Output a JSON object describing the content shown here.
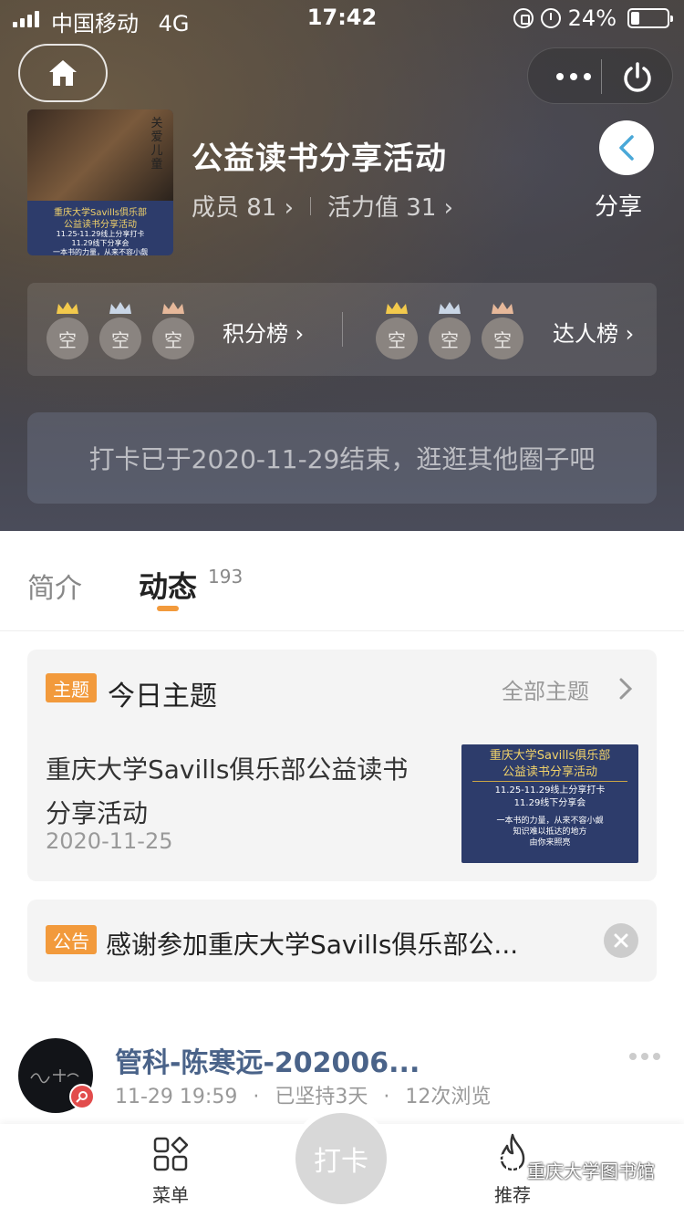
{
  "status": {
    "carrier": "中国移动",
    "network": "4G",
    "time": "17:42",
    "battery": "24%",
    "battery_level": 0.24
  },
  "circle": {
    "title": "公益读书分享活动",
    "members_label": "成员 81",
    "vitality_label": "活力值 31",
    "share_label": "分享",
    "cover": {
      "tag": "关爱儿童",
      "line1": "重庆大学Savills俱乐部",
      "line2": "公益读书分享活动",
      "line3": "11.25-11.29线上分享打卡",
      "line4": "11.29线下分享会",
      "line5": "一本书的力量，从来不容小觑"
    }
  },
  "ranks": {
    "points": {
      "label": "积分榜",
      "slots": [
        "空",
        "空",
        "空"
      ]
    },
    "experts": {
      "label": "达人榜",
      "slots": [
        "空",
        "空",
        "空"
      ]
    }
  },
  "notice": "打卡已于2020-11-29结束，逛逛其他圈子吧",
  "tabs": [
    {
      "label": "简介",
      "active": false
    },
    {
      "label": "动态",
      "active": true,
      "count": "193"
    }
  ],
  "topic_card": {
    "tag": "主题",
    "title": "今日主题",
    "all_label": "全部主题",
    "topic_title": "重庆大学Savills俱乐部公益读书分享活动",
    "date": "2020-11-25",
    "thumb": {
      "line1": "重庆大学Savills俱乐部",
      "line2": "公益读书分享活动",
      "line3": "11.25-11.29线上分享打卡",
      "line4": "11.29线下分享会",
      "line5": "一本书的力量，从来不容小觑",
      "line6": "知识难以抵达的地方",
      "line7": "由你来照亮"
    }
  },
  "announcement": {
    "tag": "公告",
    "text": "感谢参加重庆大学Savills俱乐部公..."
  },
  "post": {
    "author": "管科-陈寒远-202006...",
    "time": "11-29 19:59",
    "streak": "已坚持3天",
    "views": "12次浏览"
  },
  "bottom_nav": {
    "menu_label": "菜单",
    "checkin_label": "打卡",
    "recommend_label": "推荐"
  },
  "watermark": "重庆大学图书馆",
  "colors": {
    "accent": "#f29a3c",
    "author_link": "#4a6389"
  }
}
